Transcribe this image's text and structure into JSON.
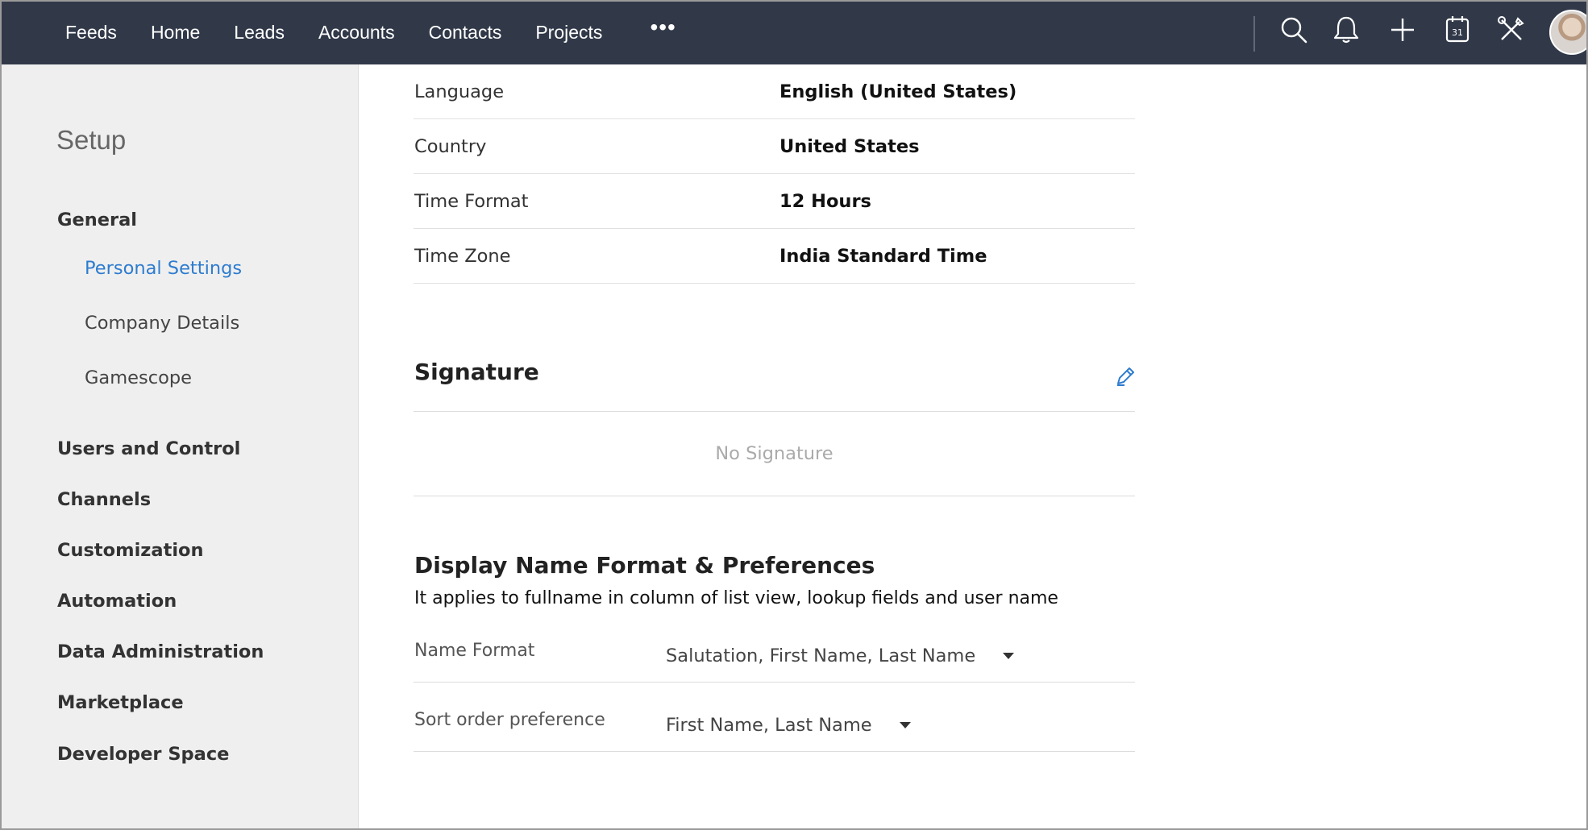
{
  "nav": {
    "items": [
      "Feeds",
      "Home",
      "Leads",
      "Accounts",
      "Contacts",
      "Projects"
    ],
    "more": "•••",
    "icons": [
      "search-icon",
      "bell-icon",
      "plus-icon",
      "calendar-icon",
      "tools-icon"
    ],
    "calendar_day": "31",
    "bg_color": "#313949"
  },
  "sidebar": {
    "title": "Setup",
    "general": "General",
    "general_items": [
      "Personal Settings",
      "Company Details",
      "Gamescope"
    ],
    "sections": [
      "Users and Control",
      "Channels",
      "Customization",
      "Automation",
      "Data Administration",
      "Marketplace",
      "Developer Space"
    ],
    "accent_color": "#2e7ccf"
  },
  "locale": [
    {
      "label": "Language",
      "value": "English (United States)"
    },
    {
      "label": "Country",
      "value": "United States"
    },
    {
      "label": "Time Format",
      "value": "12 Hours"
    },
    {
      "label": "Time Zone",
      "value": "India Standard Time"
    }
  ],
  "signature": {
    "title": "Signature",
    "empty_text": "No Signature"
  },
  "display_name": {
    "title": "Display Name Format & Preferences",
    "description": "It applies to fullname in column of list view, lookup fields and user name",
    "prefs": [
      {
        "label": "Name Format",
        "value": "Salutation, First Name, Last Name"
      },
      {
        "label": "Sort order preference",
        "value": "First Name, Last Name"
      }
    ]
  }
}
